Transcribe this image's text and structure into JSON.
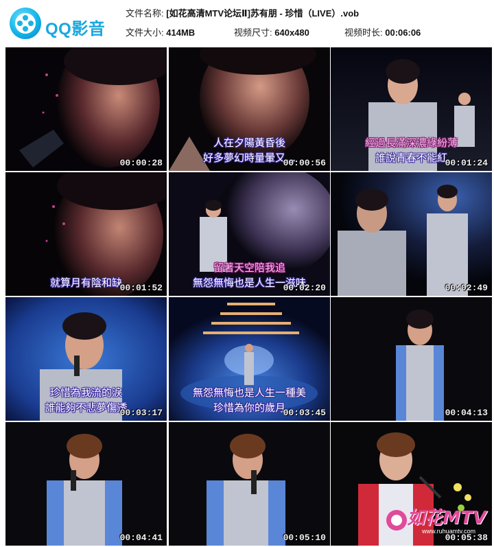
{
  "app": {
    "logo_text": "QQ影音"
  },
  "file_info": {
    "name_label": "文件名称:",
    "name_value": "[如花高清MTV论坛Ⅱ]苏有朋 - 珍惜（LIVE）.vob",
    "size_label": "文件大小:",
    "size_value": "414MB",
    "dimensions_label": "视频尺寸:",
    "dimensions_value": "640x480",
    "duration_label": "视频时长:",
    "duration_value": "00:06:06"
  },
  "thumbnails": [
    {
      "timestamp": "00:00:28",
      "subtitles": []
    },
    {
      "timestamp": "00:00:56",
      "subtitles": [
        "人在夕陽黃昏後",
        "好多夢幻時量暈又…"
      ]
    },
    {
      "timestamp": "00:01:24",
      "subtitles": [
        "經過長滿深濃綠紛薄",
        "誰說青春不能紅"
      ]
    },
    {
      "timestamp": "00:01:52",
      "subtitles": [
        "就算月有陰和缺"
      ]
    },
    {
      "timestamp": "00:02:20",
      "subtitles": [
        "留著天空陪我追",
        "無怨無悔也是人生一滋味"
      ]
    },
    {
      "timestamp": "00:02:49",
      "subtitles": []
    },
    {
      "timestamp": "00:03:17",
      "subtitles": [
        "珍惜為我流的淚",
        "誰能夠不悲夢傷透"
      ]
    },
    {
      "timestamp": "00:03:45",
      "subtitles": [
        "無怨無悔也是人生一種美",
        "珍惜為你的歲月"
      ]
    },
    {
      "timestamp": "00:04:13",
      "subtitles": []
    },
    {
      "timestamp": "00:04:41",
      "subtitles": []
    },
    {
      "timestamp": "00:05:10",
      "subtitles": []
    },
    {
      "timestamp": "00:05:38",
      "subtitles": []
    }
  ],
  "watermark": {
    "text": "如花MTV",
    "url": "www.ruhuamtv.com"
  },
  "colors": {
    "brand": "#1aa7df",
    "subtitle_outline": "#3a2a9e",
    "watermark": "#e04a9a"
  }
}
